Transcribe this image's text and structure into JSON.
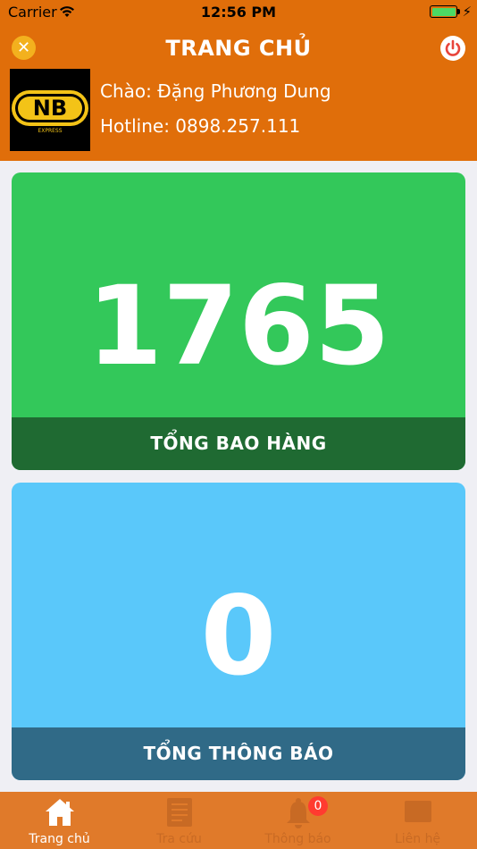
{
  "status_bar": {
    "carrier": "Carrier",
    "time": "12:56 PM"
  },
  "header": {
    "title": "TRANG CHỦ",
    "greeting": "Chào: Đặng Phương Dung",
    "hotline": "Hotline: 0898.257.111",
    "logo_text": "NB",
    "logo_subtext": "EXPRESS"
  },
  "cards": [
    {
      "value": "1765",
      "label": "TỔNG BAO HÀNG",
      "color": "#33c85a",
      "footer_color": "#1f6a32"
    },
    {
      "value": "0",
      "label": "TỔNG THÔNG BÁO",
      "color": "#5ac8fa",
      "footer_color": "#306a87"
    }
  ],
  "tabbar": {
    "items": [
      {
        "label": "Trang chủ",
        "icon": "home-icon",
        "active": true
      },
      {
        "label": "Tra cứu",
        "icon": "document-icon",
        "active": false
      },
      {
        "label": "Thông báo",
        "icon": "bell-icon",
        "active": false,
        "badge": "0"
      },
      {
        "label": "Liên hệ",
        "icon": "contact-icon",
        "active": false
      }
    ]
  },
  "colors": {
    "brand": "#e06e0a",
    "tabbar": "#e07a2a"
  }
}
